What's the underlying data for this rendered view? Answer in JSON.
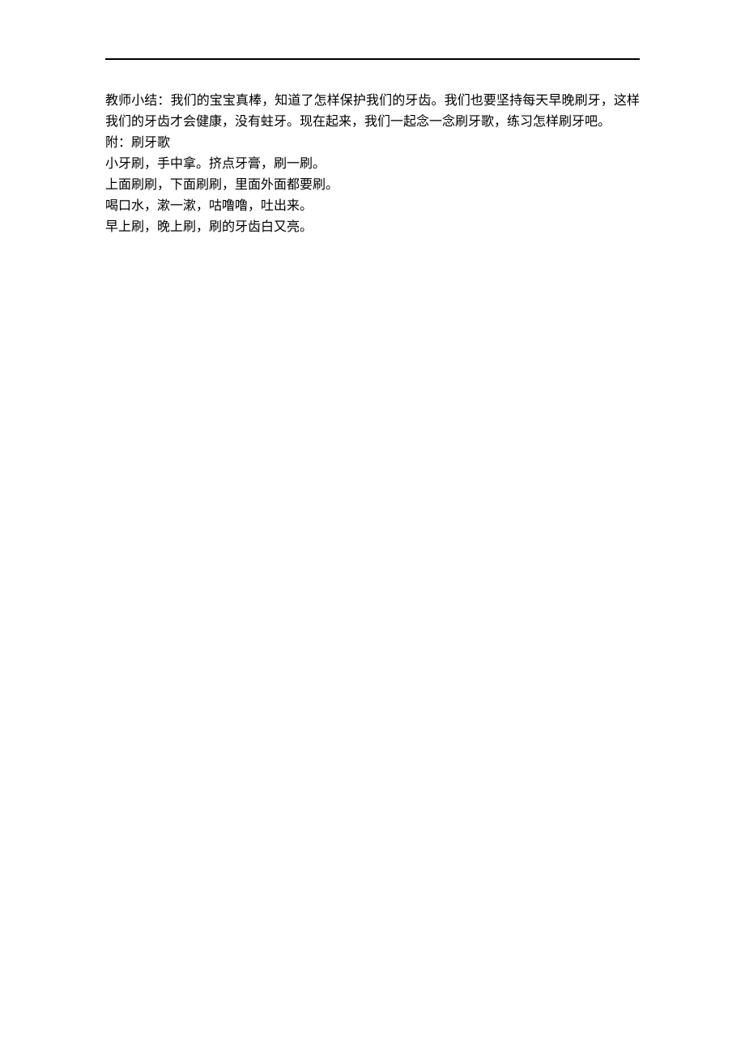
{
  "body": {
    "para_1": "教师小结：我们的宝宝真棒，知道了怎样保护我们的牙齿。我们也要坚持每天早晚刷牙，这样我们的牙齿才会健康，没有蛀牙。现在起来，我们一起念一念刷牙歌，练习怎样刷牙吧。",
    "attach_label": "附：刷牙歌",
    "line_1": "小牙刷，手中拿。挤点牙膏，刷一刷。",
    "line_2": "上面刷刷，下面刷刷，里面外面都要刷。",
    "line_3": "喝口水，漱一漱，咕噜噜，吐出来。",
    "line_4": "早上刷，晚上刷，刷的牙齿白又亮。"
  }
}
